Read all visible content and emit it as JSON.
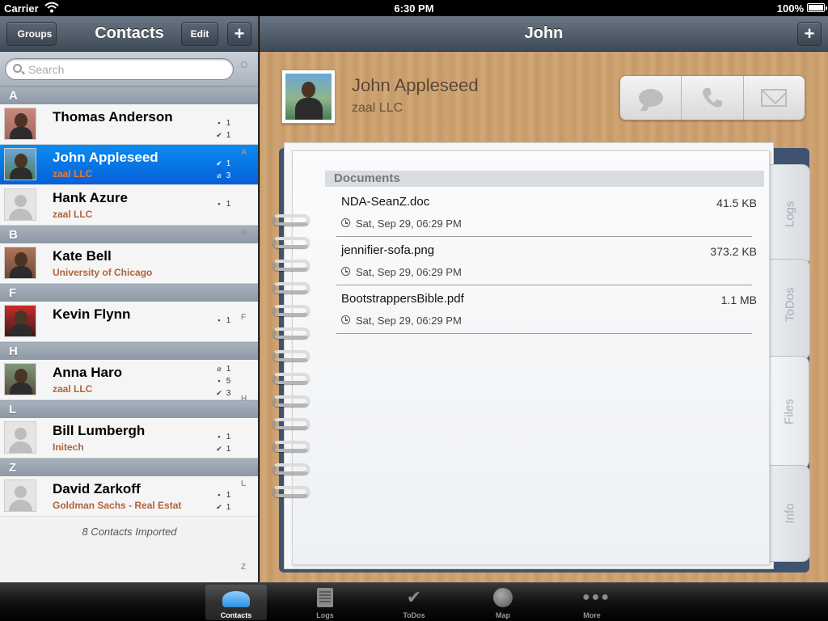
{
  "status_bar": {
    "carrier": "Carrier",
    "time": "6:30 PM",
    "battery": "100%"
  },
  "left_nav": {
    "back_label": "Groups",
    "title": "Contacts",
    "edit_label": "Edit",
    "add_label": "+"
  },
  "search": {
    "placeholder": "Search"
  },
  "sections": [
    {
      "letter": "A",
      "contacts": [
        {
          "name": "Thomas Anderson",
          "company": "",
          "counts": [
            {
              "icon": "▪",
              "n": "1"
            },
            {
              "icon": "✔",
              "n": "1"
            }
          ]
        },
        {
          "name": "John Appleseed",
          "company": "zaal LLC",
          "counts": [
            {
              "icon": "✔",
              "n": "1"
            },
            {
              "icon": "⌀",
              "n": "3"
            }
          ]
        },
        {
          "name": "Hank Azure",
          "company": "zaal LLC",
          "counts": [
            {
              "icon": "▪",
              "n": "1"
            }
          ]
        }
      ]
    },
    {
      "letter": "B",
      "contacts": [
        {
          "name": "Kate Bell",
          "company": "University of Chicago",
          "counts": []
        }
      ]
    },
    {
      "letter": "F",
      "contacts": [
        {
          "name": "Kevin Flynn",
          "company": "",
          "counts": [
            {
              "icon": "▪",
              "n": "1"
            }
          ]
        }
      ]
    },
    {
      "letter": "H",
      "contacts": [
        {
          "name": "Anna Haro",
          "company": "zaal LLC",
          "counts": [
            {
              "icon": "⌀",
              "n": "1"
            },
            {
              "icon": "▪",
              "n": "5"
            },
            {
              "icon": "✔",
              "n": "3"
            }
          ]
        }
      ]
    },
    {
      "letter": "L",
      "contacts": [
        {
          "name": "Bill Lumbergh",
          "company": "Initech",
          "counts": [
            {
              "icon": "▪",
              "n": "1"
            },
            {
              "icon": "✔",
              "n": "1"
            }
          ]
        }
      ]
    },
    {
      "letter": "Z",
      "contacts": [
        {
          "name": "David Zarkoff",
          "company": "Goldman Sachs - Real Estat",
          "counts": [
            {
              "icon": "▪",
              "n": "1"
            },
            {
              "icon": "✔",
              "n": "1"
            }
          ]
        }
      ]
    }
  ],
  "index_letters": [
    "A",
    "B",
    "F",
    "H",
    "L",
    "Z"
  ],
  "list_footer": "8 Contacts Imported",
  "right_nav": {
    "title": "John",
    "add_label": "+"
  },
  "contact_header": {
    "name": "John Appleseed",
    "company": "zaal LLC"
  },
  "documents": {
    "header": "Documents",
    "items": [
      {
        "name": "NDA-SeanZ.doc",
        "size": "41.5 KB",
        "date": "Sat, Sep 29, 06:29 PM"
      },
      {
        "name": "jennifier-sofa.png",
        "size": "373.2 KB",
        "date": "Sat, Sep 29, 06:29 PM"
      },
      {
        "name": "BootstrappersBible.pdf",
        "size": "1.1 MB",
        "date": "Sat, Sep 29, 06:29 PM"
      }
    ]
  },
  "notebook_tabs": [
    "Logs",
    "ToDos",
    "Files",
    "Info"
  ],
  "active_notebook_tab": "Files",
  "tab_bar": [
    {
      "label": "Contacts",
      "icon": "people-icon",
      "active": true
    },
    {
      "label": "Logs",
      "icon": "notepad-icon",
      "active": false
    },
    {
      "label": "ToDos",
      "icon": "checkmark-icon",
      "active": false
    },
    {
      "label": "Map",
      "icon": "globe-icon",
      "active": false
    },
    {
      "label": "More",
      "icon": "more-dots-icon",
      "active": false
    }
  ]
}
